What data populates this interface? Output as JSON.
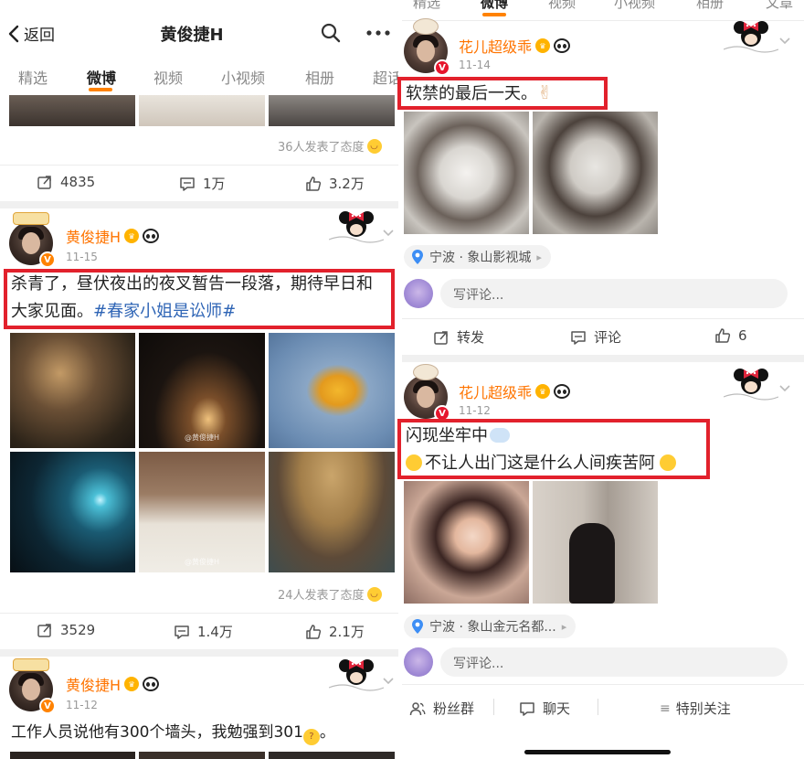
{
  "left": {
    "header": {
      "back_label": "返回",
      "title": "黄俊捷H"
    },
    "tabs": [
      "精选",
      "微博",
      "视频",
      "小视频",
      "相册",
      "超话"
    ],
    "post1_footer": {
      "reaction_text": "36人发表了态度",
      "repost_count": "4835",
      "comment_count": "1万",
      "like_count": "3.2万"
    },
    "post2": {
      "author": "黄俊捷H",
      "date": "11-15",
      "text_line1": "杀青了，昼伏夜出的夜叉暂告一段落，期待早日和",
      "text_line2": "大家见面。",
      "hashtag": "#春家小姐是讼师#",
      "watermark": "@黄俊捷H",
      "reaction_text": "24人发表了态度",
      "repost_count": "3529",
      "comment_count": "1.4万",
      "like_count": "2.1万"
    },
    "post3": {
      "author": "黄俊捷H",
      "date": "11-12",
      "text": "工作人员说他有300个墙头，我勉强到301",
      "text_end": "。"
    }
  },
  "right": {
    "tabs": [
      "精选",
      "微博",
      "视频",
      "小视频",
      "相册",
      "文章"
    ],
    "postA": {
      "author": "花儿超级乖",
      "date": "11-14",
      "text": "软禁的最后一天。",
      "emoji": "✌",
      "location": "宁波 · 象山影视城",
      "comment_placeholder": "写评论...",
      "repost_label": "转发",
      "comment_label": "评论",
      "like_count": "6"
    },
    "postB": {
      "author": "花儿超级乖",
      "date": "11-12",
      "text_line1": "闪现坐牢中",
      "text_line2": "不让人出门这是什么人间疾苦阿",
      "location": "宁波 · 象山金元名都...",
      "comment_placeholder": "写评论..."
    },
    "bottom_bar": {
      "fans_group": "粉丝群",
      "chat": "聊天",
      "special_follow": "特别关注"
    }
  },
  "colors": {
    "accent_orange": "#ff8200",
    "username_orange": "#ff7400",
    "hashtag_blue": "#2e64b5",
    "highlight_red": "#e2212c"
  }
}
